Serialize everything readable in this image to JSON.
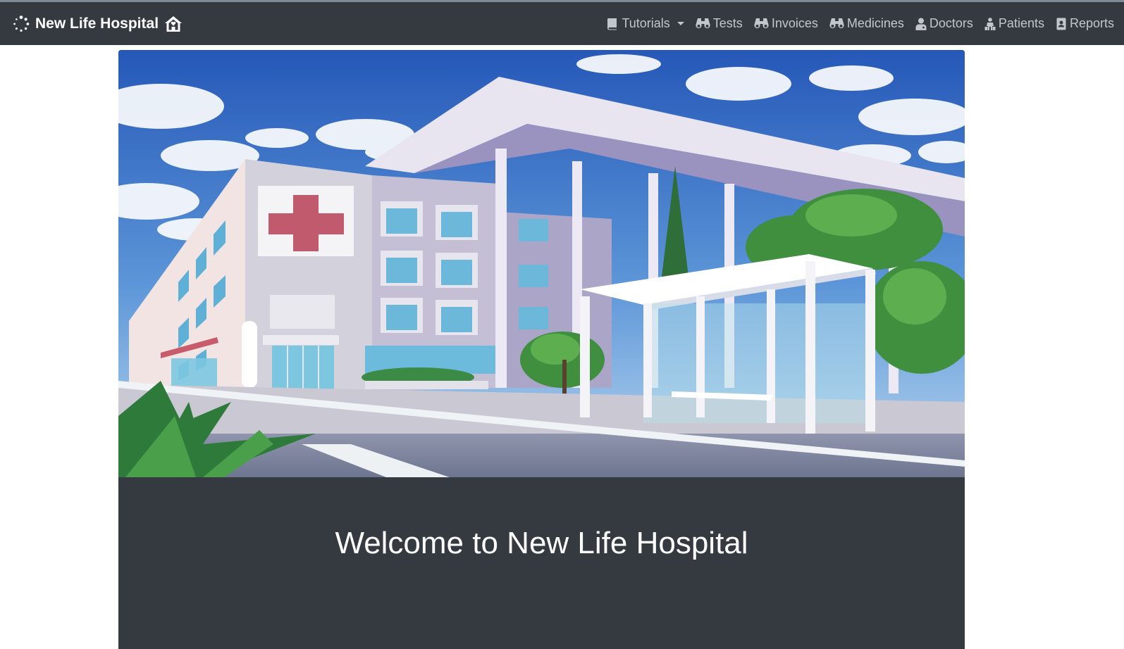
{
  "navbar": {
    "brand": {
      "label": "New Life Hospital",
      "spinner_icon": "loading-spinner-icon",
      "home_icon": "house-icon"
    },
    "items": [
      {
        "label": "Tutorials",
        "icon": "book-icon",
        "dropdown": true
      },
      {
        "label": "Tests",
        "icon": "binoculars-icon"
      },
      {
        "label": "Invoices",
        "icon": "binoculars-icon"
      },
      {
        "label": "Medicines",
        "icon": "binoculars-icon"
      },
      {
        "label": "Doctors",
        "icon": "user-icon"
      },
      {
        "label": "Patients",
        "icon": "person-icon"
      },
      {
        "label": "Reports",
        "icon": "contact-book-icon"
      }
    ]
  },
  "hero": {
    "image": "hospital-illustration"
  },
  "main": {
    "welcome": "Welcome to New Life Hospital"
  },
  "colors": {
    "navbar": "#343a40",
    "nav_text": "#c3c7cb",
    "card": "#343a40",
    "cross": "#c25a6e"
  }
}
